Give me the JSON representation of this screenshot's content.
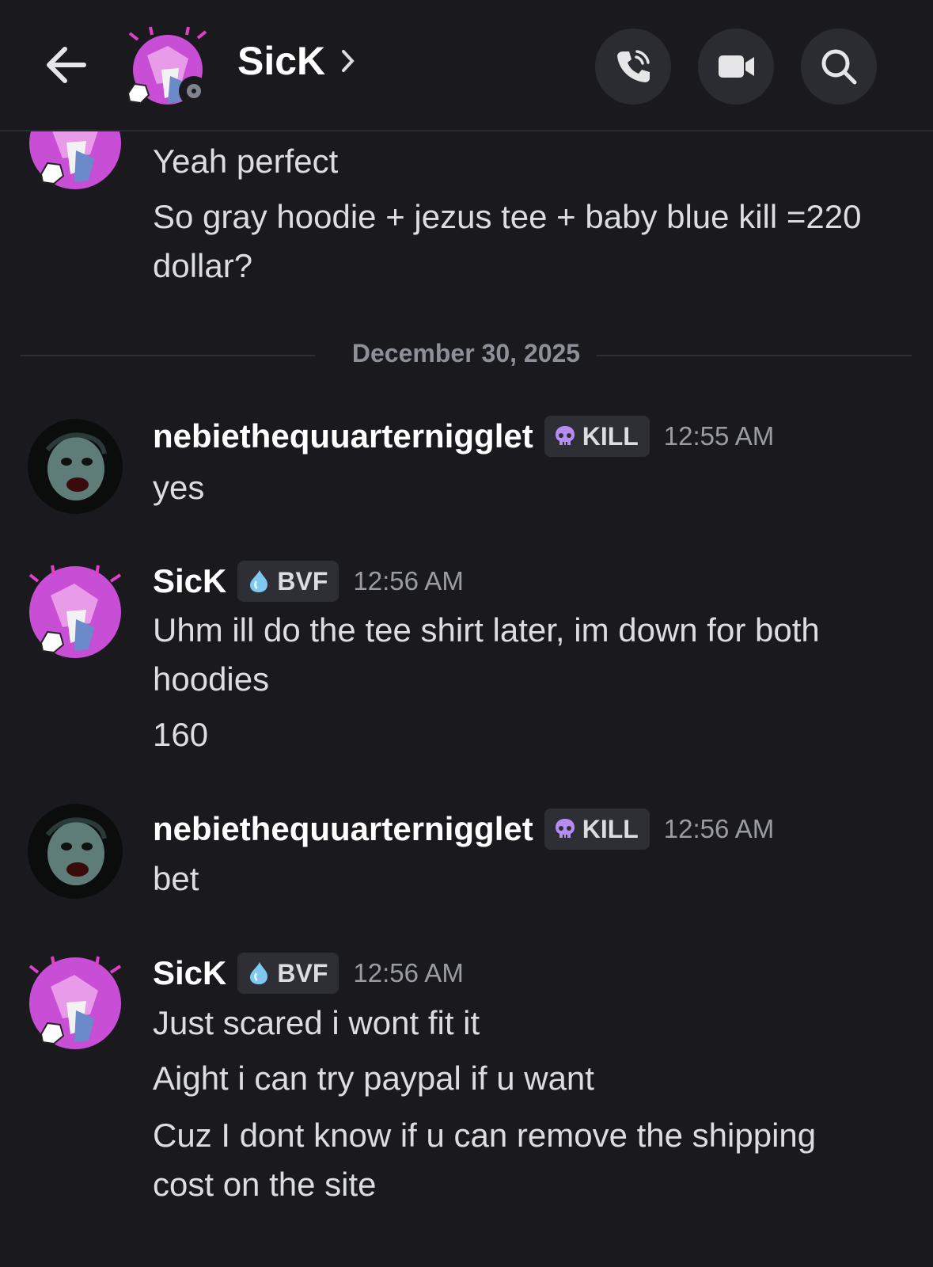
{
  "header": {
    "title": "SicK",
    "icons": {
      "back": "back-arrow-icon",
      "chevron": "chevron-right-icon",
      "call": "phone-call-icon",
      "video": "video-camera-icon",
      "search": "search-icon"
    },
    "status": "offline"
  },
  "top_message": {
    "lines": [
      "Yeah perfect",
      "So gray hoodie + jezus tee + baby blue kill =220",
      "dollar?"
    ]
  },
  "date_divider": "December 30, 2025",
  "messages": [
    {
      "author": "nebiethequuarternigglet",
      "tag": "KILL",
      "tag_icon": "skull-icon",
      "time": "12:55 AM",
      "lines": [
        "yes"
      ]
    },
    {
      "author": "SicK",
      "tag": "BVF",
      "tag_icon": "water-drop-icon",
      "time": "12:56 AM",
      "lines": [
        "Uhm ill do the tee shirt later, im down for both",
        "hoodies",
        "160"
      ]
    },
    {
      "author": "nebiethequuarternigglet",
      "tag": "KILL",
      "tag_icon": "skull-icon",
      "time": "12:56 AM",
      "lines": [
        "bet"
      ]
    },
    {
      "author": "SicK",
      "tag": "BVF",
      "tag_icon": "water-drop-icon",
      "time": "12:56 AM",
      "lines": [
        "Just scared i wont fit it",
        "Aight i can try paypal if u want",
        "Cuz I dont know if u can remove the shipping",
        "cost on the site"
      ]
    }
  ],
  "colors": {
    "background": "#1a1a1e",
    "tag_bg": "#2e2f35",
    "kill_skull": "#b68cf2",
    "bvf_drop": "#7fc8f0",
    "avatar_pink": "#d25cdc"
  }
}
